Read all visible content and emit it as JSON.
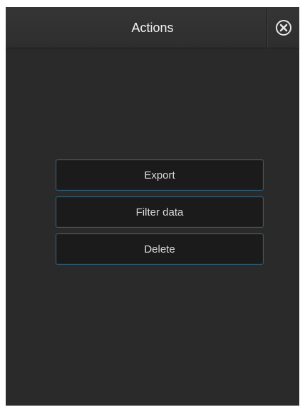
{
  "header": {
    "title": "Actions",
    "close_icon": "close-circle-icon"
  },
  "menu": {
    "items": [
      {
        "label": "Export"
      },
      {
        "label": "Filter data"
      },
      {
        "label": "Delete"
      }
    ]
  },
  "colors": {
    "background": "#2a2a2a",
    "header": "#333333",
    "button_background": "#1b1b1b",
    "button_border": "#2f5f7a",
    "text": "#f2f2f2"
  }
}
